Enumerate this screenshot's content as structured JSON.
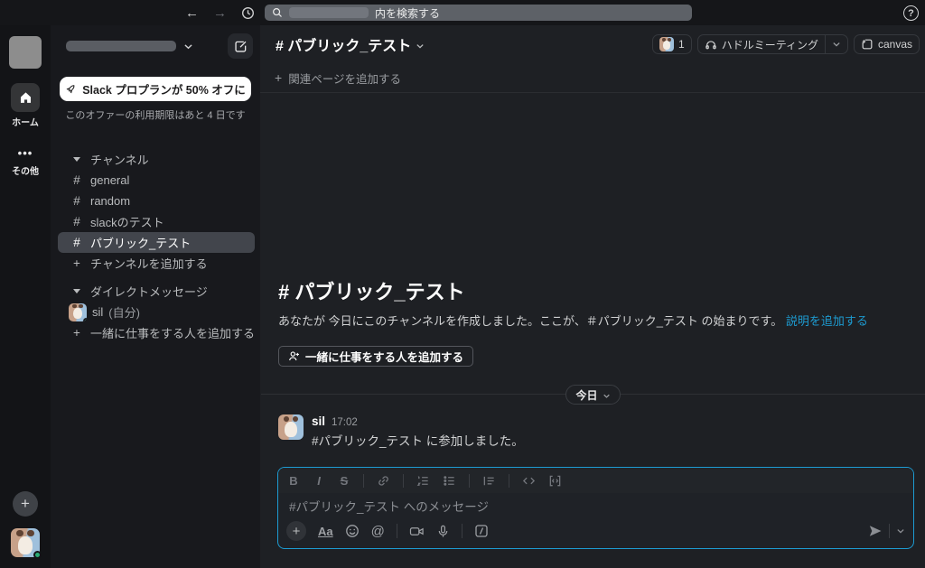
{
  "topbar": {
    "search_text": "内を検索する"
  },
  "icons": {
    "hash": "#",
    "plus": "+",
    "help": "?",
    "back": "←",
    "forward": "→",
    "dots": "•••",
    "at": "@"
  },
  "rail": {
    "home_label": "ホーム",
    "more_label": "その他"
  },
  "sidebar": {
    "banner": {
      "title": "Slack プロプランが 50% オフに",
      "subtitle": "このオファーの利用期限はあと 4 日です"
    },
    "channels": {
      "header": "チャンネル",
      "items": [
        {
          "label": "general"
        },
        {
          "label": "random"
        },
        {
          "label": "slackのテスト"
        },
        {
          "label": "パブリック_テスト"
        }
      ],
      "add_label": "チャンネルを追加する"
    },
    "dms": {
      "header": "ダイレクトメッセージ",
      "user": "sil",
      "user_suffix": "(自分)",
      "add_label": "一緒に仕事をする人を追加する"
    }
  },
  "header": {
    "channel_title": "# パブリック_テスト",
    "member_count": "1",
    "huddle_label": "ハドルミーティング",
    "canvas_label": "canvas",
    "add_page_label": "関連ページを追加する"
  },
  "intro": {
    "title": "# パブリック_テスト",
    "body": "あなたが 今日にこのチャンネルを作成しました。ここが、＃パブリック_テスト の始まりです。",
    "link": "説明を追加する",
    "add_people_label": "一緒に仕事をする人を追加する"
  },
  "messages": {
    "date_divider": "今日",
    "items": [
      {
        "author": "sil",
        "time": "17:02",
        "text": "#パブリック_テスト に参加しました。"
      }
    ]
  },
  "composer": {
    "placeholder": "#パブリック_テスト へのメッセージ",
    "bold": "B",
    "italic": "I",
    "strike": "S",
    "aa": "Aa"
  },
  "colors": {
    "accent_blue": "#1d9bd1",
    "presence_green": "#2bac76",
    "selected_row": "#42454c"
  }
}
